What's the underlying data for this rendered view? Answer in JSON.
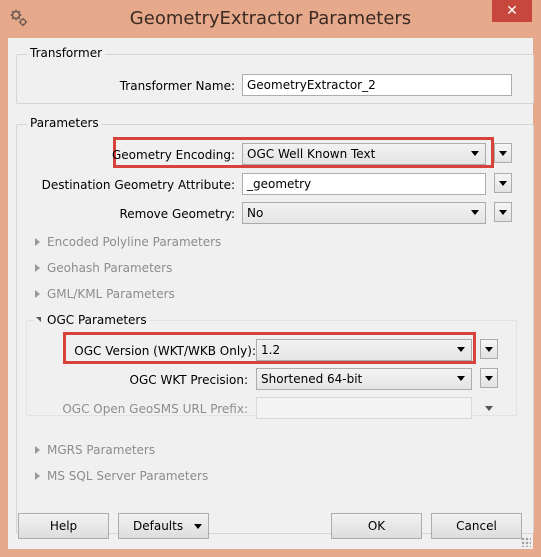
{
  "window": {
    "title": "GeometryExtractor Parameters",
    "close_symbol": "✕",
    "accent_color": "#e6a98c",
    "highlight_color": "#d9423b"
  },
  "transformer_group": {
    "title": "Transformer",
    "name_label": "Transformer Name:",
    "name_value": "GeometryExtractor_2"
  },
  "parameters_group": {
    "title": "Parameters",
    "geometry_encoding": {
      "label": "Geometry Encoding:",
      "value": "OGC Well Known Text"
    },
    "destination_attribute": {
      "label": "Destination Geometry Attribute:",
      "value": "_geometry"
    },
    "remove_geometry": {
      "label": "Remove Geometry:",
      "value": "No"
    },
    "sections": [
      {
        "label": "Encoded Polyline Parameters",
        "expanded": false
      },
      {
        "label": "Geohash Parameters",
        "expanded": false
      },
      {
        "label": "GML/KML Parameters",
        "expanded": false
      },
      {
        "label": "OGC Parameters",
        "expanded": true
      },
      {
        "label": "MGRS Parameters",
        "expanded": false
      },
      {
        "label": "MS SQL Server Parameters",
        "expanded": false
      }
    ],
    "ogc": {
      "version": {
        "label": "OGC Version (WKT/WKB Only):",
        "value": "1.2"
      },
      "wkt_precision": {
        "label": "OGC WKT Precision:",
        "value": "Shortened 64-bit"
      },
      "geosms_prefix": {
        "label": "OGC Open GeoSMS URL Prefix:",
        "value": ""
      }
    }
  },
  "footer": {
    "help": "Help",
    "defaults": "Defaults",
    "ok": "OK",
    "cancel": "Cancel"
  },
  "icons": [
    "app-icon",
    "close-icon",
    "dropdown-arrow-icon",
    "expand-triangle-icon",
    "collapse-triangle-icon",
    "resize-grip-icon"
  ]
}
